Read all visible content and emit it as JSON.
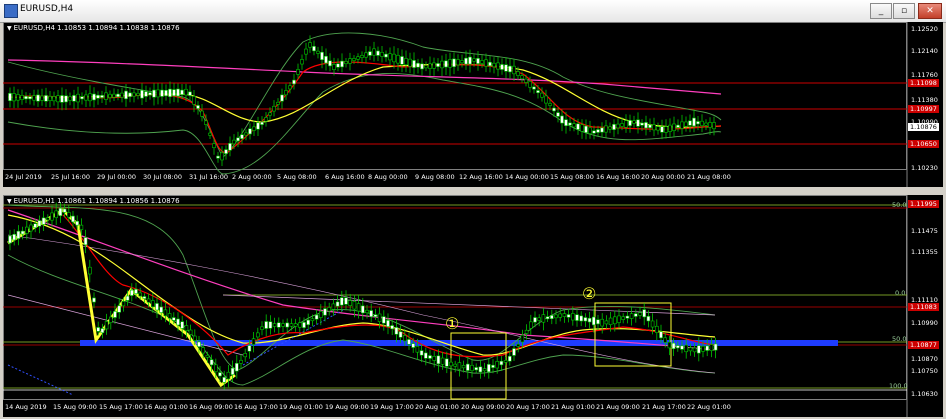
{
  "window": {
    "title": "EURUSD,H4",
    "btn_min": "_",
    "btn_max": "▫",
    "btn_close": "✕"
  },
  "top": {
    "info": "EURUSD,H4  1.10853 1.10894 1.10838 1.10876",
    "prices": [
      "1.12520",
      "1.12140",
      "1.11760",
      "1.11380",
      "1.10990",
      "1.10610",
      "1.10230"
    ],
    "tags": {
      "red1": "1.11098",
      "red2": "1.10997",
      "current": "1.10876",
      "red3": "1.10650"
    },
    "times": [
      "24 Jul 2019",
      "25 Jul 16:00",
      "29 Jul 00:00",
      "30 Jul 08:00",
      "31 Jul 16:00",
      "2 Aug 00:00",
      "5 Aug 08:00",
      "6 Aug 16:00",
      "8 Aug 00:00",
      "9 Aug 08:00",
      "12 Aug 16:00",
      "14 Aug 00:00",
      "15 Aug 08:00",
      "16 Aug 16:00",
      "20 Aug 00:00",
      "21 Aug 08:00"
    ]
  },
  "bottom": {
    "info": "EURUSD,H1  1.10861 1.10894 1.10856 1.10876",
    "prices": [
      "1.11475",
      "1.11355",
      "1.11110",
      "1.10990",
      "1.10870",
      "1.10750",
      "1.10630"
    ],
    "tags": {
      "top": "1.11995",
      "red1": "1.11083",
      "current": "1.10877"
    },
    "fibo": {
      "top": "50.0",
      "mid": "0.0",
      "low": "50.0",
      "bottom": "100.0"
    },
    "markers": {
      "one": "①",
      "two": "②"
    },
    "times": [
      "14 Aug 2019",
      "15 Aug 09:00",
      "15 Aug 17:00",
      "16 Aug 01:00",
      "16 Aug 09:00",
      "16 Aug 17:00",
      "19 Aug 01:00",
      "19 Aug 09:00",
      "19 Aug 17:00",
      "20 Aug 01:00",
      "20 Aug 09:00",
      "20 Aug 17:00",
      "21 Aug 01:00",
      "21 Aug 09:00",
      "21 Aug 17:00",
      "22 Aug 01:00"
    ]
  },
  "colors": {
    "bg": "#000000",
    "bull": "#ffffff",
    "bear": "#00c800",
    "ma_red": "#ff0000",
    "ma_yellow": "#ffff33",
    "ma_pink": "#ff3fbf",
    "bands": "#4fa34f",
    "zone": "#1e3cff"
  }
}
